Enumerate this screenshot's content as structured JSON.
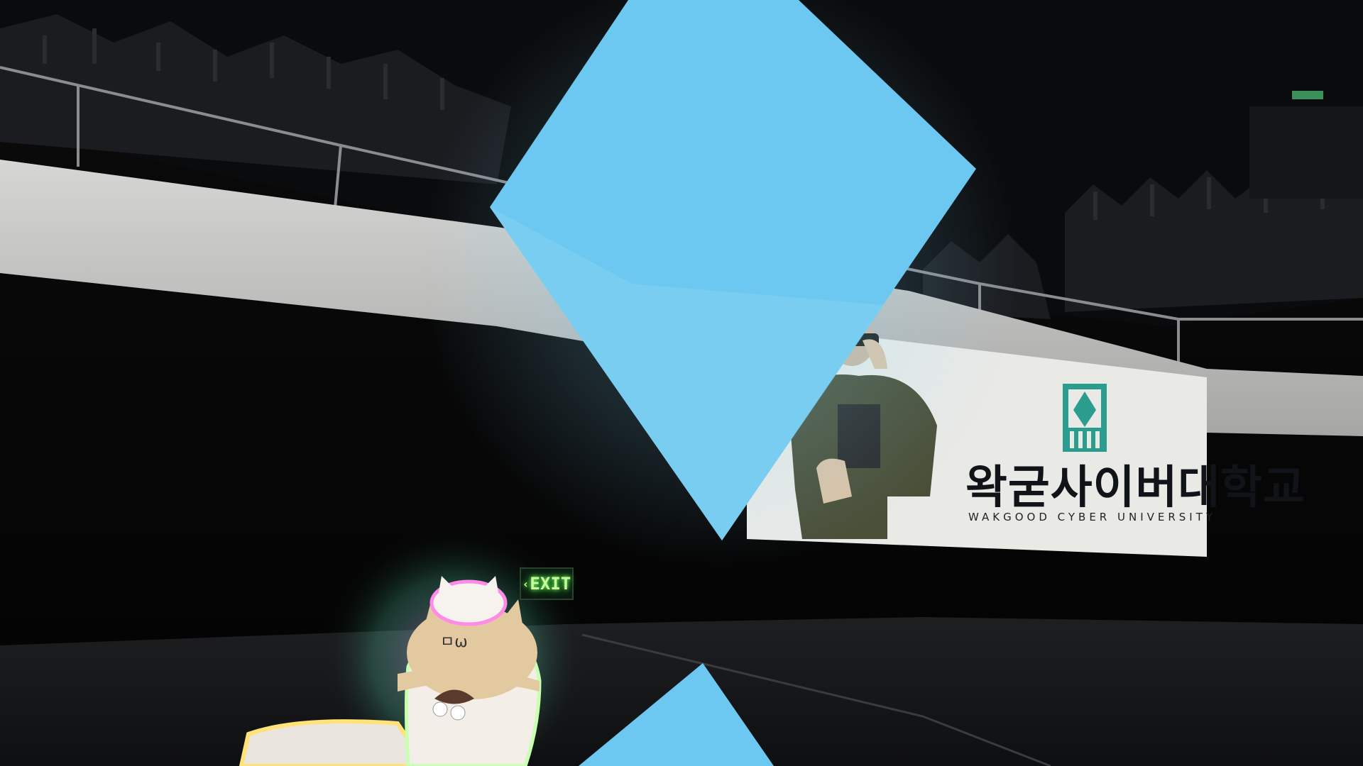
{
  "banner": {
    "korean_name": "왁굳사이버대학교",
    "english_name": "WAKGOOD CYBER UNIVERSITY",
    "accent_color": "#2a9d8f"
  },
  "exit_sign": {
    "arrow": "‹",
    "label": "EXIT",
    "color": "#b8ff8a"
  },
  "crystal": {
    "color": "#6cc8f0"
  },
  "player_avatar": {
    "icon": "cat-avatar-icon"
  }
}
